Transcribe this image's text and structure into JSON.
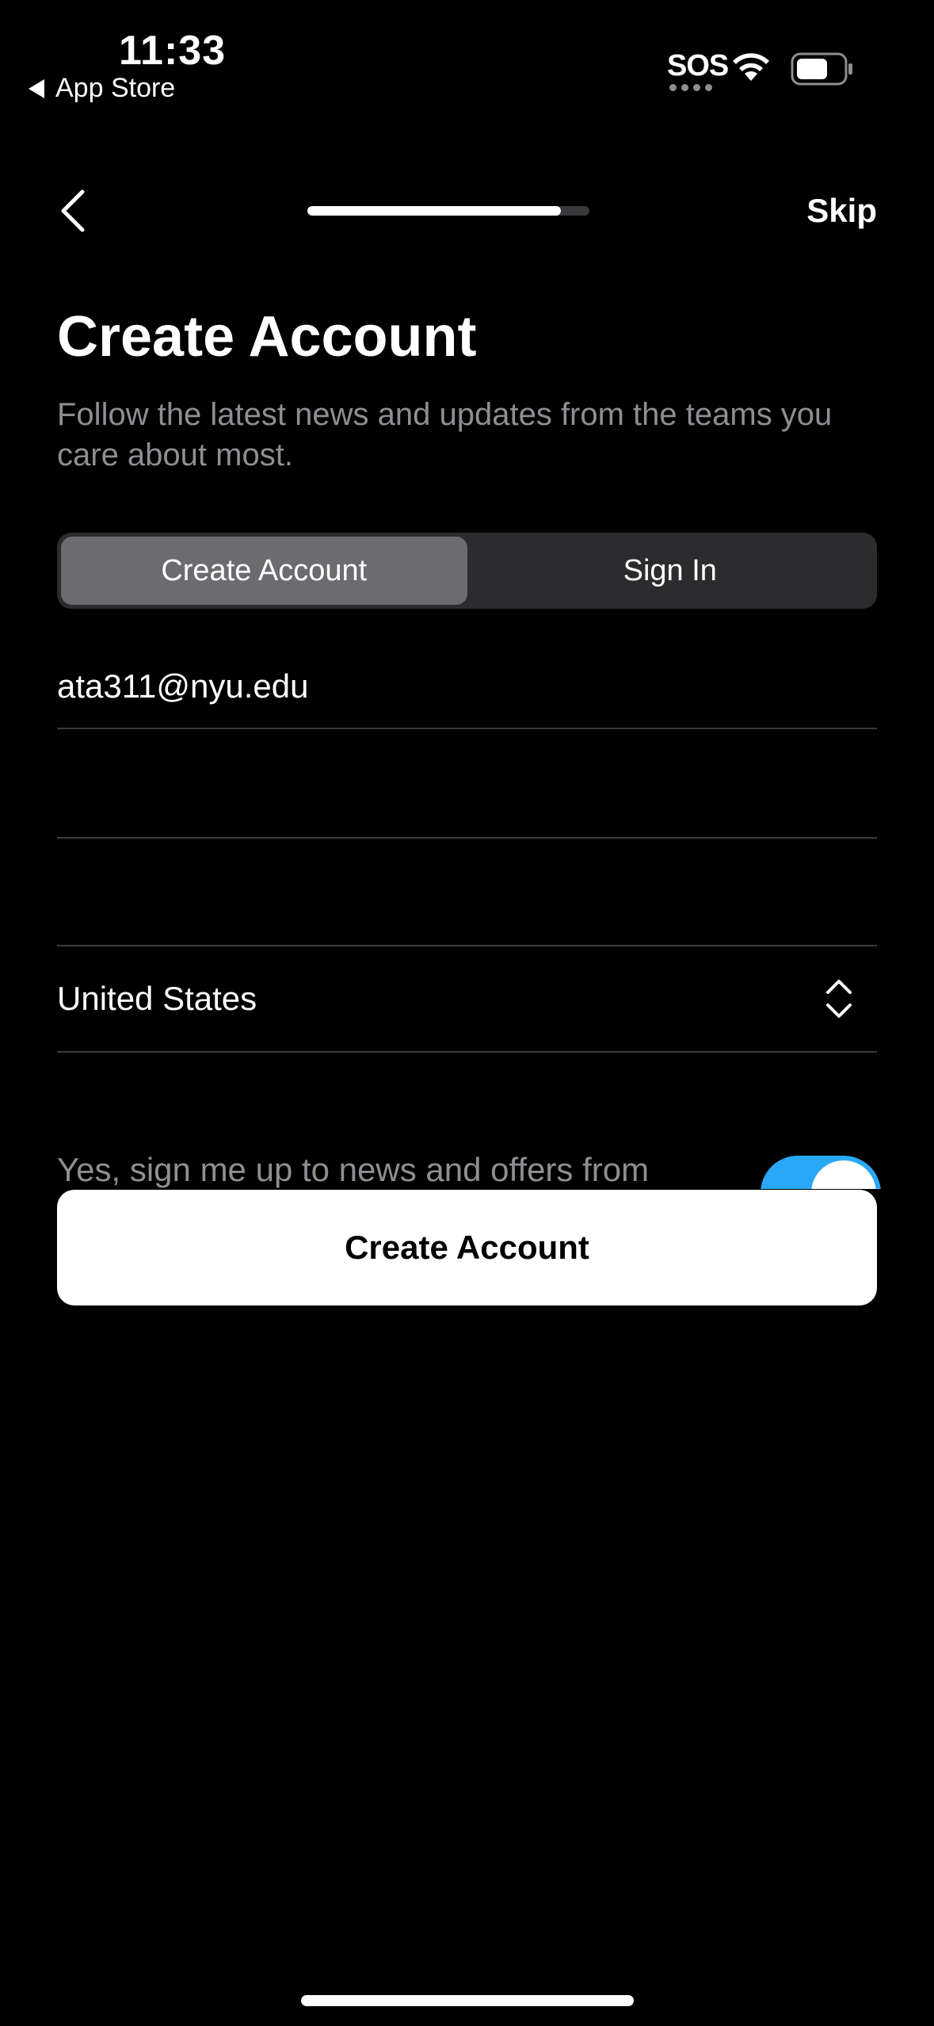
{
  "status_bar": {
    "time": "11:33",
    "back_app_label": "App Store",
    "sos_label": "SOS"
  },
  "nav": {
    "skip_label": "Skip",
    "progress_fraction": 0.9
  },
  "header": {
    "title": "Create Account",
    "subtitle": "Follow the latest news and updates from the teams you care about most."
  },
  "segmented": {
    "options": [
      "Create Account",
      "Sign In"
    ],
    "selected": "Create Account"
  },
  "form": {
    "email_value": "ata311@nyu.edu",
    "country_value": "United States",
    "optin_text": "Yes, sign me up to news and offers from",
    "optin_enabled": true
  },
  "primary_button": {
    "label": "Create Account"
  },
  "colors": {
    "background": "#000000",
    "toggle_on": "#2aa8f8",
    "secondary_text": "#8e8e93",
    "segment_active": "#6c6c70"
  },
  "icons": {
    "back": "chevron-left-icon",
    "country_picker": "chevron-up-down-icon",
    "wifi": "wifi-icon",
    "battery": "battery-icon"
  }
}
